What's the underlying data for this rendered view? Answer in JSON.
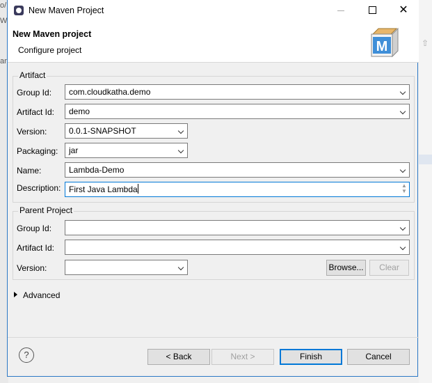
{
  "background": {
    "left_frag_1": "o/",
    "left_frag_2": "W",
    "left_frag_3": "an"
  },
  "window": {
    "title": "New Maven Project"
  },
  "header": {
    "title": "New Maven project",
    "subtitle": "Configure project",
    "icon_letter": "M"
  },
  "artifact": {
    "legend": "Artifact",
    "group_id_label": "Group Id:",
    "group_id_value": "com.cloudkatha.demo",
    "artifact_id_label": "Artifact Id:",
    "artifact_id_value": "demo",
    "version_label": "Version:",
    "version_value": "0.0.1-SNAPSHOT",
    "packaging_label": "Packaging:",
    "packaging_value": "jar",
    "name_label": "Name:",
    "name_value": "Lambda-Demo",
    "description_label": "Description:",
    "description_value": "First Java Lambda"
  },
  "parent": {
    "legend": "Parent Project",
    "group_id_label": "Group Id:",
    "group_id_value": "",
    "artifact_id_label": "Artifact Id:",
    "artifact_id_value": "",
    "version_label": "Version:",
    "version_value": "",
    "browse_label": "Browse...",
    "clear_label": "Clear"
  },
  "advanced": {
    "label": "Advanced"
  },
  "footer": {
    "help": "?",
    "back_label": "< Back",
    "next_label": "Next >",
    "finish_label": "Finish",
    "cancel_label": "Cancel"
  },
  "colors": {
    "focus": "#0078d7",
    "window_bg": "#f0f0f0"
  }
}
